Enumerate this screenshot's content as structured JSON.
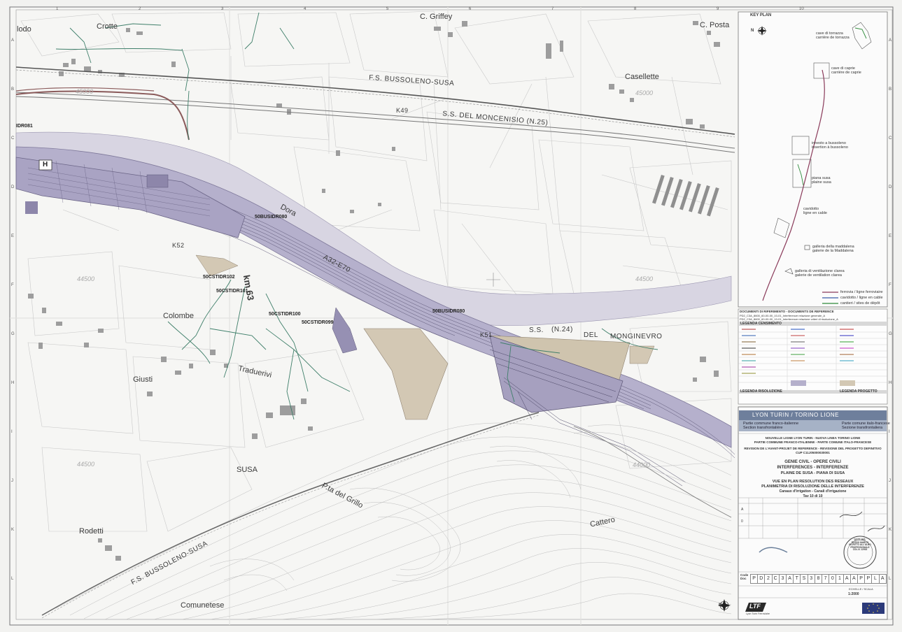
{
  "map": {
    "places": {
      "crotte": "Crotte",
      "griffey": "C. Griffey",
      "posta": "C. Posta",
      "casellette": "Casellette",
      "colombe": "Colombe",
      "giusti": "Giusti",
      "traduerivi": "Traduerivi",
      "susa": "SUSA",
      "rodetti": "Rodetti",
      "comunetese": "Comunetese",
      "cattero": "Cattero",
      "grillo": "P.ta del Grillo",
      "dora": "Dora",
      "nodo": "lodo"
    },
    "roads": {
      "fs_top": "F.S. BUSSOLENO-SUSA",
      "fs_bottom": "F.S. BUSSOLENO-SUSA",
      "ss25": "S.S. DEL MONCENISIO (N.25)",
      "ss24_a": "S.S.",
      "ss24_b": "(N.24)",
      "ss24_c": "DEL",
      "ss24_d": "MONGINEVRO",
      "a32": "A32-E70"
    },
    "km": {
      "k49": "K49",
      "k52": "K52",
      "k51": "K51",
      "km63": "km 63"
    },
    "codes": {
      "c1": "50BUSIDR080",
      "c2": "50BUSIDR080",
      "c3": "50CSTIDR102",
      "c4": "50CSTIDR101",
      "c5": "50CSTIDR100",
      "c6": "50CSTIDR099",
      "c7": "IDR081"
    },
    "contours": {
      "a": "45000",
      "b": "45000",
      "c": "44500",
      "d": "44500",
      "e": "44500",
      "f": "44000"
    },
    "heli": "H",
    "grid_cols": [
      "1",
      "2",
      "3",
      "4",
      "5",
      "6",
      "7",
      "8",
      "9",
      "10"
    ],
    "grid_rows": [
      "A",
      "B",
      "C",
      "D",
      "E",
      "F",
      "G",
      "H",
      "I",
      "J",
      "K",
      "L"
    ]
  },
  "key_plan": {
    "title": "KEY PLAN",
    "north": "N",
    "torrazza": "cave di torrazza\ncarrière de torrazza",
    "caprie": "cave di caprie\ncarrière de caprie",
    "bussoleno": "innesto a bussoleno\ninsertion à bussoleno",
    "piana": "piana susa\nplaine susa",
    "cavidotto": "cavidotto\nligne en cable",
    "maddalena": "galleria della maddalena\ngalerie de la Maddalena",
    "clarea": "galleria di ventilazione clarea\ngalerie de ventilation clarea",
    "legend": [
      "ferrovia / ligne ferroviaire",
      "cavidotto / ligne en cable",
      "cantieri / sites de dépôt"
    ]
  },
  "refs": {
    "title": "DOCUMENTI DI RIFERIMENTO - DOCUMENTS DE REFERENCE",
    "line1": "PD2_C3A_8600_60-00-00_10-01_Interferenze relazione generale_A",
    "line2": "PD2_C3A_8600_60-00-00_10-01_Interferenze relazione criteri di risoluzione_A"
  },
  "legend": {
    "censimento": "LEGENDA CENSIMENTO",
    "risoluzione": "LEGENDA RISOLUZIONE",
    "progetto": "LEGENDA PROGETTO"
  },
  "title_block": {
    "brand": "LYON TURIN / TORINO LIONE",
    "sub_left_1": "Partie commune franco-italienne",
    "sub_left_2": "Section transfrontalière",
    "sub_right_1": "Parte comune italo-francese",
    "sub_right_2": "Sezione transfrontaliera",
    "l1": "NOUVELLE LIGNE LYON TURIN - NUOVA LINEA TORINO LIONE",
    "l2": "PARTIE COMMUNE FRANCO-ITALIENNE - PARTE COMUNE ITALO-FRANCESE",
    "l3": "REVISION DE L'AVANT-PROJET DE REFERENCE - REVISIONE DEL PROGETTO DEFINITIVO",
    "l4": "CUP C11J05000030001",
    "l5": "GENIE CIVIL - OPERE CIVILI",
    "l6": "INTERFERENCES - INTERFERENZE",
    "l7": "PLAINE DE SUSA - PIANA DI SUSA",
    "l8": "VUE EN PLAN RESOLUTION DES RESEAUX",
    "l9": "PLANIMETRIA DI RISOLUZIONE DELLE INTERFERENZE",
    "l10": "Canaux d'Irrigation - Canali d'irrigazione",
    "l11": "Tav 10 di 10",
    "rev_a": "A",
    "rev_0": "0",
    "scale_label": "ECHELLE / SCALA",
    "scale": "1:2000",
    "code_label": "Code\nDoc",
    "code": [
      "P",
      "D",
      "2",
      "C",
      "3",
      "A",
      "T",
      "S",
      "3",
      "8",
      "7",
      "0",
      "1",
      "A",
      "A",
      "P",
      "P",
      "L",
      "A"
    ],
    "ltf": "LTF",
    "ltf_sub": "Lyon Turin Ferroviaire",
    "stamp": "DOTT. ING.\nRUSSO MARCO\nISCRITTO ALL'ALBO\nPROFESSIONALE\nCOL.N. 12902"
  }
}
